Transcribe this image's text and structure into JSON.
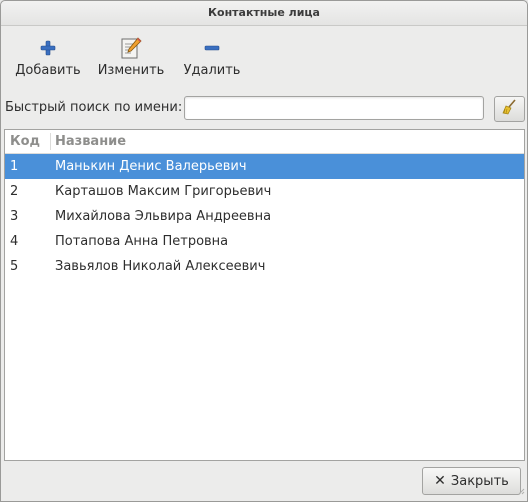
{
  "window": {
    "title": "Контактные лица"
  },
  "toolbar": {
    "add_label": "Добавить",
    "edit_label": "Изменить",
    "delete_label": "Удалить"
  },
  "search": {
    "label": "Быстрый поиск по имени:",
    "value": "",
    "placeholder": ""
  },
  "table": {
    "columns": [
      "Код",
      "Название"
    ],
    "rows": [
      {
        "code": "1",
        "name": "Манькин Денис Валерьевич",
        "selected": true
      },
      {
        "code": "2",
        "name": "Карташов Максим Григорьевич",
        "selected": false
      },
      {
        "code": "3",
        "name": "Михайлова Эльвира Андреевна",
        "selected": false
      },
      {
        "code": "4",
        "name": "Потапова Анна Петровна",
        "selected": false
      },
      {
        "code": "5",
        "name": "Завьялов Николай Алексеевич",
        "selected": false
      }
    ]
  },
  "footer": {
    "close_label": "Закрыть"
  },
  "colors": {
    "selection": "#4a90d9",
    "icon_blue": "#2f63b0"
  },
  "icons": {
    "add": "plus-icon",
    "edit": "pencil-notepad-icon",
    "delete": "minus-icon",
    "clear": "broom-icon",
    "close": "close-icon"
  }
}
